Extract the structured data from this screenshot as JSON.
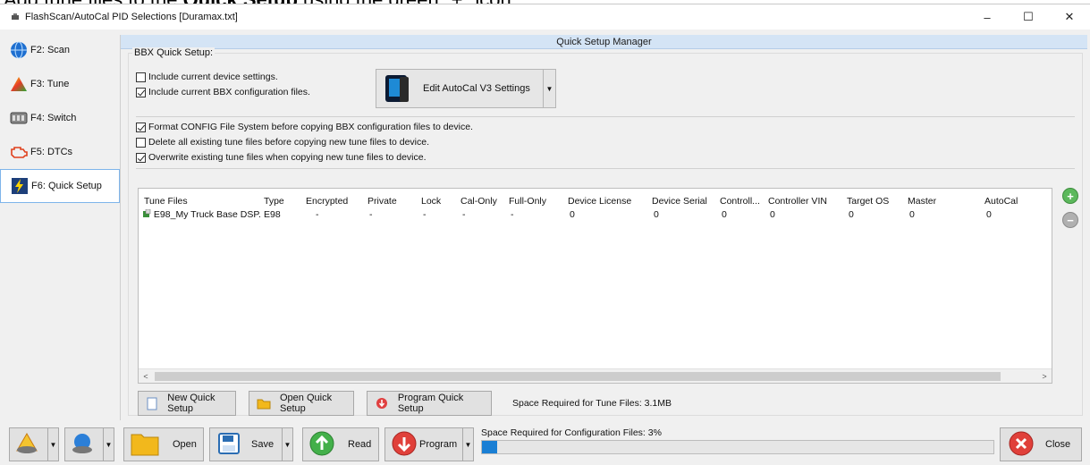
{
  "banner": {
    "text_prefix": "Add tune files to the ",
    "bold": "Quick Setup",
    "text_suffix": " using the green \"+\" icon."
  },
  "window": {
    "title": "FlashScan/AutoCal PID Selections [Duramax.txt]",
    "minimize": "–",
    "maximize": "☐",
    "close": "✕"
  },
  "nav": [
    {
      "label": "F2: Scan",
      "icon": "globe-icon"
    },
    {
      "label": "F3: Tune",
      "icon": "triangle-icon"
    },
    {
      "label": "F4: Switch",
      "icon": "switch-icon"
    },
    {
      "label": "F5: DTCs",
      "icon": "engine-icon"
    },
    {
      "label": "F6: Quick Setup",
      "icon": "lightning-icon"
    }
  ],
  "main": {
    "header": "Quick Setup Manager",
    "group_label": "BBX Quick Setup:",
    "options_top": [
      {
        "label": "Include current device settings.",
        "checked": false
      },
      {
        "label": "Include current BBX configuration files.",
        "checked": true
      }
    ],
    "edit_button": "Edit AutoCal V3 Settings",
    "options_mid": [
      {
        "label": "Format CONFIG File System before copying BBX configuration files to device.",
        "checked": true
      },
      {
        "label": "Delete all existing tune files before copying new tune files to device.",
        "checked": false
      },
      {
        "label": "Overwrite existing tune files when copying new tune files to device.",
        "checked": true
      }
    ],
    "table": {
      "columns": [
        "Tune Files",
        "Type",
        "Encrypted",
        "Private",
        "Lock",
        "Cal-Only",
        "Full-Only",
        "Device License",
        "Device Serial",
        "Controll...",
        "Controller VIN",
        "Target OS",
        "Master",
        "AutoCal"
      ],
      "rows": [
        [
          "E98_My Truck Base DSP...",
          "E98",
          "-",
          "-",
          "-",
          "-",
          "-",
          "0",
          "0",
          "0",
          "0",
          "0",
          "0",
          "0"
        ]
      ]
    },
    "buttons": {
      "new": "New Quick Setup",
      "open": "Open Quick Setup",
      "program": "Program Quick Setup"
    },
    "space_tune": "Space Required for Tune Files: 3.1MB"
  },
  "toolbar": {
    "open": "Open",
    "save": "Save",
    "read": "Read",
    "program": "Program",
    "close": "Close",
    "space_cfg": "Space Required for Configuration Files: 3%",
    "progress_percent": 3
  },
  "colors": {
    "accent": "#1a7fd4",
    "header_bg": "#d4e4f5",
    "active_border": "#7eb4ea"
  }
}
